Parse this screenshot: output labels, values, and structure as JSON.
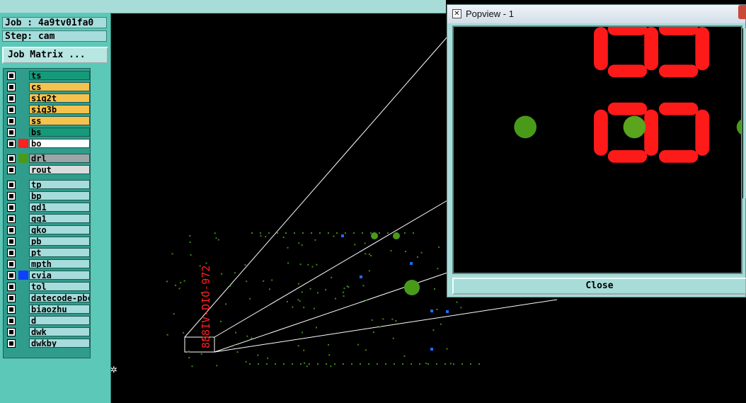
{
  "job": {
    "label": "Job : 4a9tv01fa0"
  },
  "step": {
    "label": "Step: cam"
  },
  "matrix_button": "Job Matrix ...",
  "layers": [
    {
      "name": "ts",
      "bg": "#179a7a",
      "swatch": ""
    },
    {
      "name": "cs",
      "bg": "#f6c24e",
      "swatch": ""
    },
    {
      "name": "sig2t",
      "bg": "#f6c24e",
      "swatch": ""
    },
    {
      "name": "sig3b",
      "bg": "#f6c24e",
      "swatch": ""
    },
    {
      "name": "ss",
      "bg": "#f6c24e",
      "swatch": ""
    },
    {
      "name": "bs",
      "bg": "#179a7a",
      "swatch": ""
    },
    {
      "name": "bo",
      "bg": "#ffffff",
      "swatch": "#ff2020"
    },
    {
      "name": "drl",
      "bg": "#9aa7a6",
      "swatch": "#4a9a1a"
    },
    {
      "name": "rout",
      "bg": "#d8dcdc",
      "swatch": ""
    },
    {
      "name": "tp",
      "bg": "#a6dcdc",
      "swatch": ""
    },
    {
      "name": "bp",
      "bg": "#a6dcdc",
      "swatch": ""
    },
    {
      "name": "gd1",
      "bg": "#a6dcdc",
      "swatch": ""
    },
    {
      "name": "gg1",
      "bg": "#a6dcdc",
      "swatch": ""
    },
    {
      "name": "gko",
      "bg": "#a6dcdc",
      "swatch": ""
    },
    {
      "name": "pb",
      "bg": "#a6dcdc",
      "swatch": ""
    },
    {
      "name": "pt",
      "bg": "#a6dcdc",
      "swatch": ""
    },
    {
      "name": "mpth",
      "bg": "#a6dcdc",
      "swatch": ""
    },
    {
      "name": "cvia",
      "bg": "#a6dcdc",
      "swatch": "#1040ff"
    },
    {
      "name": "tol",
      "bg": "#a6dcdc",
      "swatch": ""
    },
    {
      "name": "datecode-pbc",
      "bg": "#a6dcdc",
      "swatch": ""
    },
    {
      "name": "biaozhu",
      "bg": "#a6dcdc",
      "swatch": ""
    },
    {
      "name": "d",
      "bg": "#a6dcdc",
      "swatch": ""
    },
    {
      "name": "dwk",
      "bg": "#a6dcdc",
      "swatch": ""
    },
    {
      "name": "dwkby",
      "bg": "#a6dcdc",
      "swatch": ""
    }
  ],
  "canvas": {
    "board_text": "888IV-DIO-972",
    "text_color": "#ff2020",
    "pad_color": "#4a9a1a",
    "via_color": "#1e6cff"
  },
  "popup": {
    "title": "Popview - 1",
    "close_label": "Close"
  },
  "colors": {
    "panel": "#5cc8b8",
    "panel_light": "#a8dcd8",
    "drill_green": "#4a9a1a",
    "outline_red": "#ff0000"
  }
}
